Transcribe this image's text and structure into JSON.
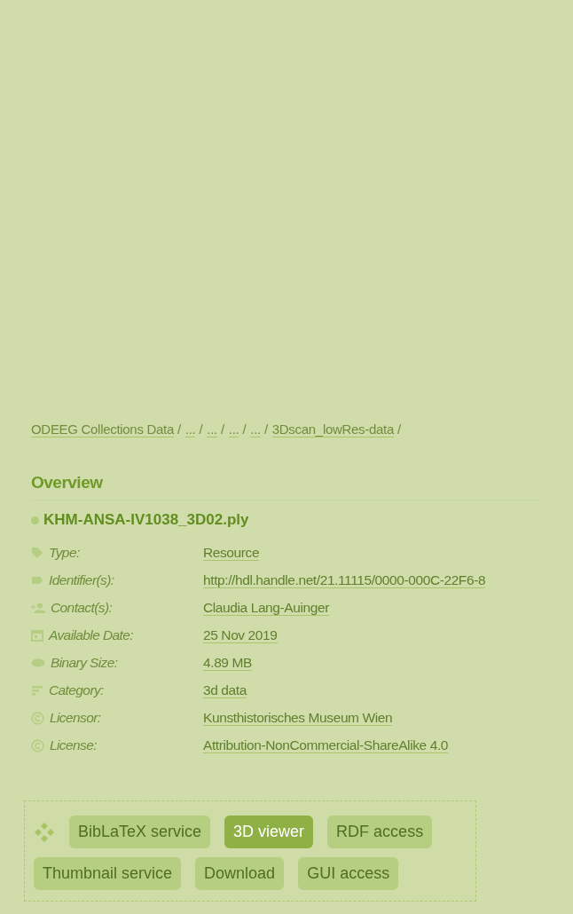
{
  "breadcrumb": [
    {
      "label": "ODEEG Collections Data",
      "separator": "/"
    },
    {
      "label": "...",
      "separator": "/"
    },
    {
      "label": "...",
      "separator": "/"
    },
    {
      "label": "...",
      "separator": "/"
    },
    {
      "label": "...",
      "separator": "/"
    },
    {
      "label": "3Dscan_lowRes-data",
      "separator": "/"
    }
  ],
  "overview": {
    "heading": "Overview",
    "file_name": "KHM-ANSA-IV1038_3D02.ply",
    "fields": [
      {
        "kind": "tag",
        "label": "Type:",
        "value": "Resource"
      },
      {
        "kind": "label",
        "label": "Identifier(s):",
        "value": "http://hdl.handle.net/21.11115/0000-000C-22F6-8"
      },
      {
        "kind": "contact",
        "label": "Contact(s):",
        "value": "Claudia Lang-Auinger"
      },
      {
        "kind": "date",
        "label": "Available Date:",
        "value": "25 Nov 2019"
      },
      {
        "kind": "size",
        "label": "Binary Size:",
        "value": "4.89 MB"
      },
      {
        "kind": "category",
        "label": "Category:",
        "value": "3d data"
      },
      {
        "kind": "copyright",
        "label": "Licensor:",
        "value": "Kunsthistorisches Museum Wien"
      },
      {
        "kind": "copyright",
        "label": "License:",
        "value": "Attribution-NonCommercial-ShareAlike 4.0"
      }
    ]
  },
  "services": [
    {
      "label": "BibLaTeX service",
      "selected": false
    },
    {
      "label": "3D viewer",
      "selected": true
    },
    {
      "label": "RDF access",
      "selected": false
    },
    {
      "label": "Thumbnail service",
      "selected": false
    },
    {
      "label": "Download",
      "selected": false
    },
    {
      "label": "GUI access",
      "selected": false
    }
  ]
}
